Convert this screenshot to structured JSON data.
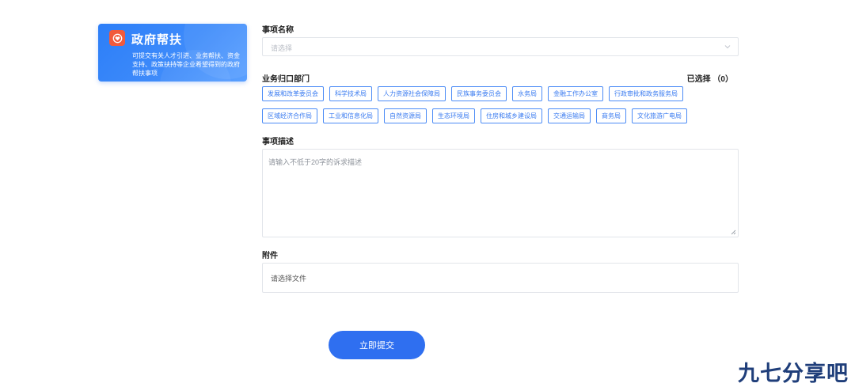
{
  "card": {
    "title": "政府帮扶",
    "description": "可提交有关人才引进、业务帮扶、资金支持、政策扶持等企业希望得到的政府帮扶事项",
    "icon": "heart-badge-icon"
  },
  "form": {
    "item_name": {
      "label": "事项名称",
      "placeholder": "请选择"
    },
    "department": {
      "label": "业务归口部门",
      "selected_text": "已选择 （0）",
      "row1": [
        "发展和改革委员会",
        "科学技术局",
        "人力资源社会保障局",
        "民族事务委员会",
        "水务局",
        "金融工作办公室",
        "行政审批和政务服务局"
      ],
      "row2": [
        "区域经济合作局",
        "工业和信息化局",
        "自然资源局",
        "生态环境局",
        "住房和城乡建设局",
        "交通运输局",
        "商务局",
        "文化旅游广电局"
      ]
    },
    "description": {
      "label": "事项描述",
      "placeholder": "请输入不低于20字的诉求描述"
    },
    "attachment": {
      "label": "附件",
      "placeholder": "请选择文件"
    },
    "submit_label": "立即提交"
  },
  "watermark": "九七分享吧",
  "colors": {
    "accent": "#2f6ff0",
    "tag_border": "#4c8cf6",
    "card_icon": "#f15a3c"
  }
}
